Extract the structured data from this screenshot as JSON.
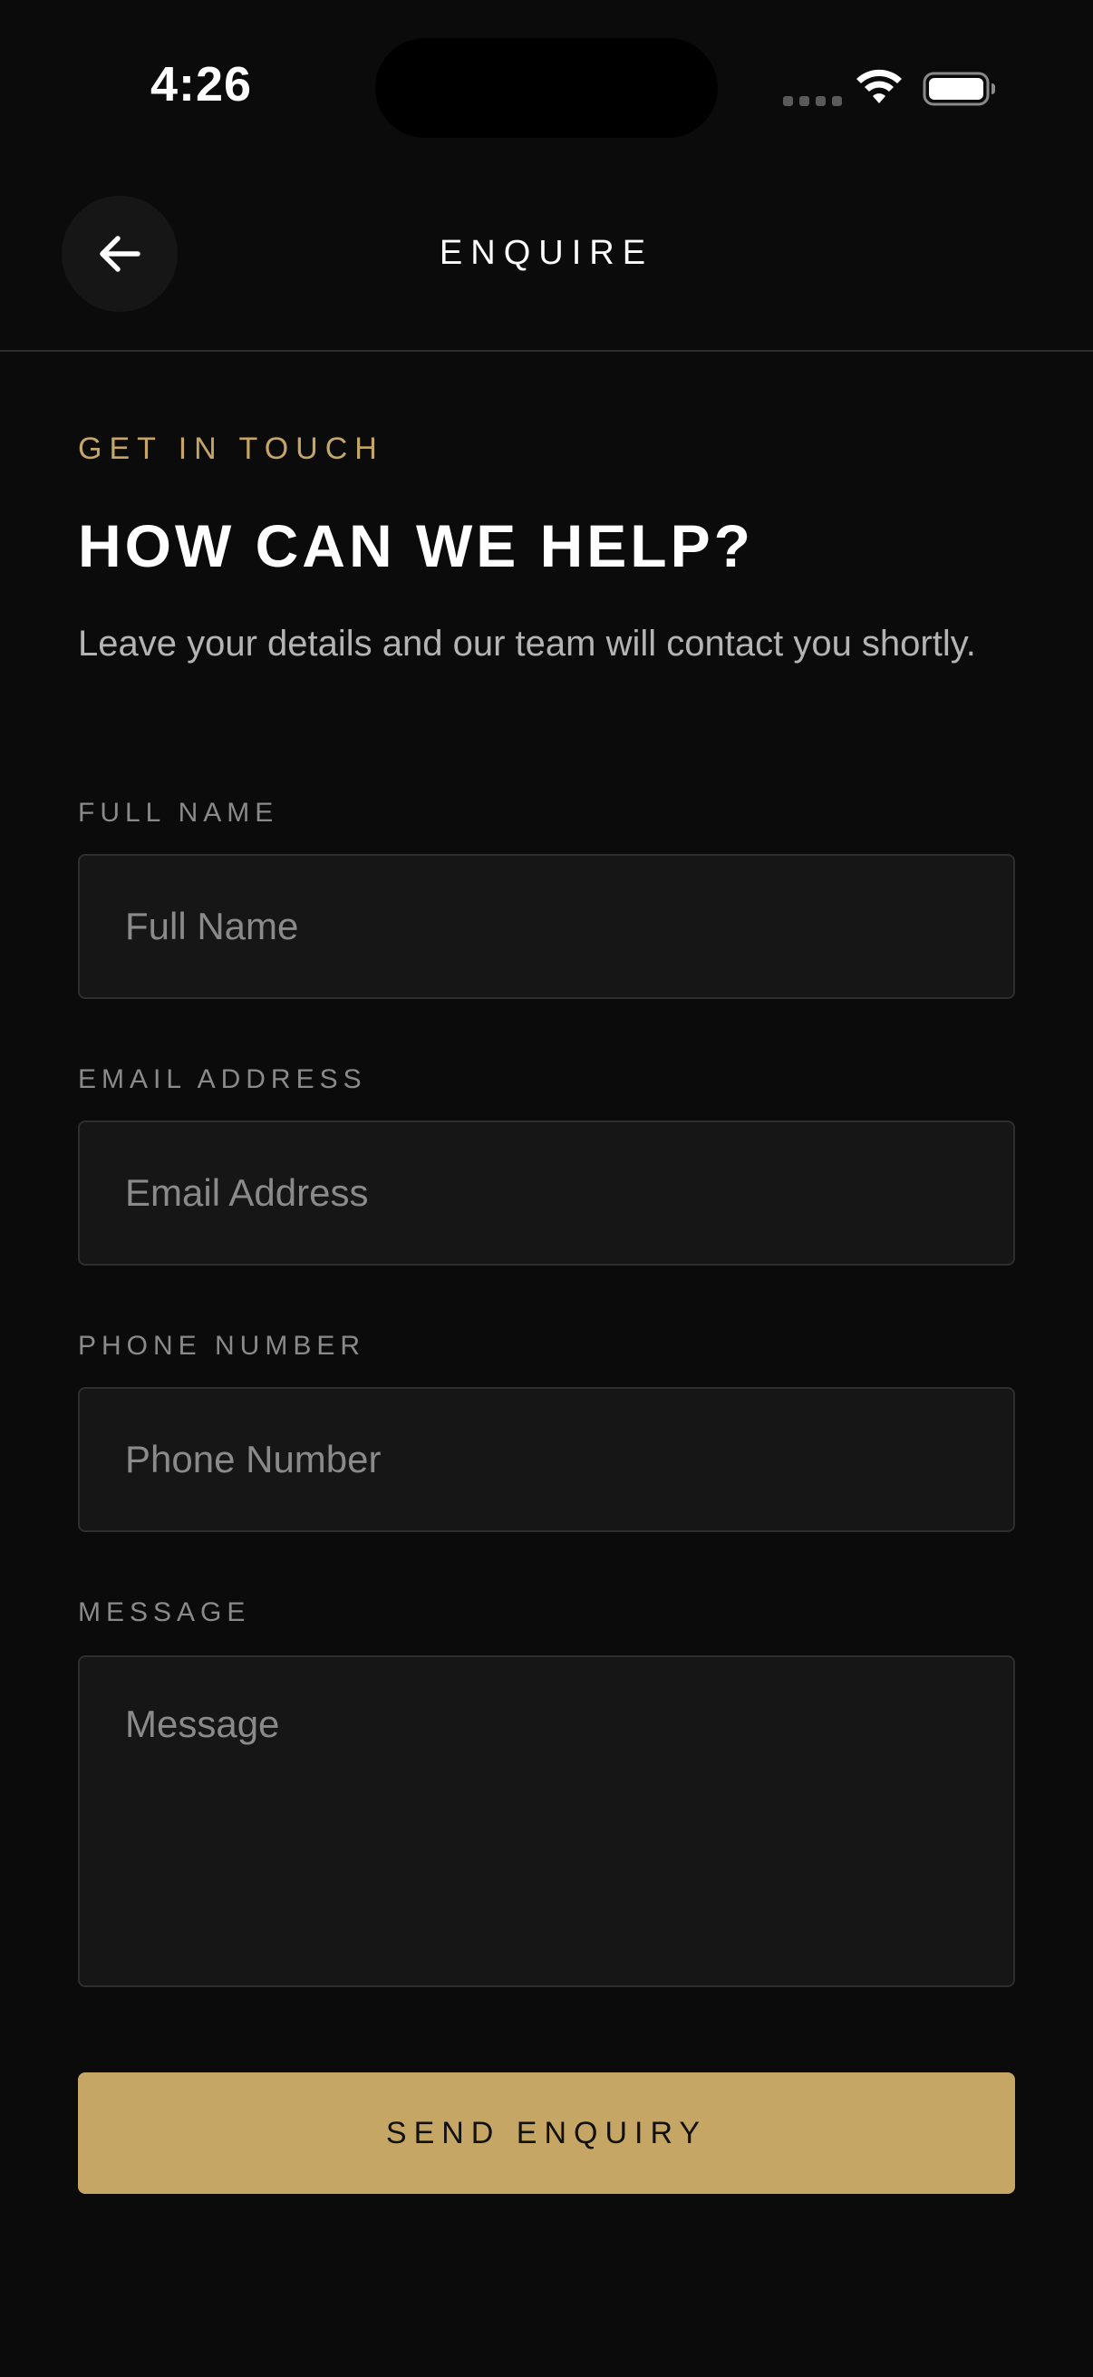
{
  "status_bar": {
    "time": "4:26"
  },
  "header": {
    "title": "ENQUIRE",
    "back_icon": "arrow-left-icon"
  },
  "intro": {
    "eyebrow": "GET IN TOUCH",
    "title": "HOW CAN WE HELP?",
    "subtitle": "Leave your details and our team will contact you shortly."
  },
  "form": {
    "full_name": {
      "label": "FULL NAME",
      "placeholder": "Full Name",
      "value": ""
    },
    "email": {
      "label": "EMAIL ADDRESS",
      "placeholder": "Email Address",
      "value": ""
    },
    "phone": {
      "label": "PHONE NUMBER",
      "placeholder": "Phone Number",
      "value": ""
    },
    "message": {
      "label": "MESSAGE",
      "placeholder": "Message",
      "value": ""
    },
    "submit_label": "SEND ENQUIRY"
  },
  "colors": {
    "background": "#0b0b0b",
    "accent": "#c6a664",
    "field_background": "#161616",
    "field_border": "#2e2e2e",
    "label": "#8a8a8a"
  }
}
